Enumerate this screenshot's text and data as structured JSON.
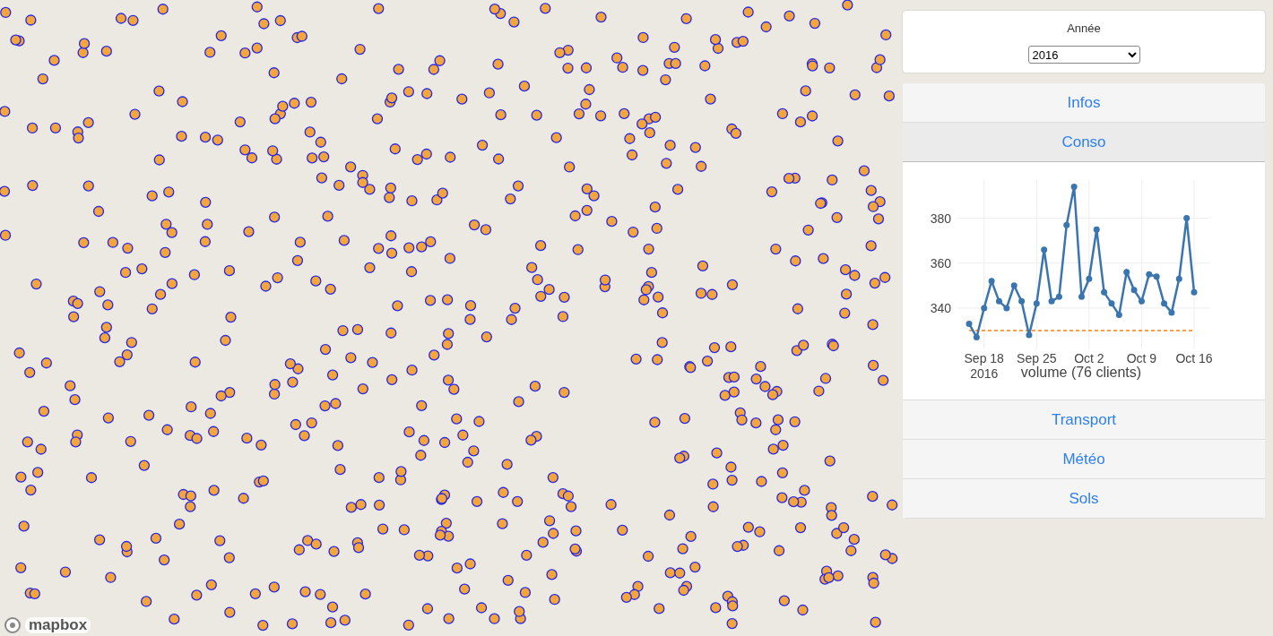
{
  "map": {
    "attribution": "mapbox"
  },
  "panel": {
    "year": {
      "label": "Année",
      "value": "2016"
    },
    "sections": [
      {
        "label": "Infos",
        "expanded": false
      },
      {
        "label": "Conso",
        "expanded": true,
        "chart_data": {
          "type": "line",
          "xlabel": "volume (76 clients)",
          "x": [
            "2016-09-16",
            "2016-09-17",
            "2016-09-18",
            "2016-09-19",
            "2016-09-20",
            "2016-09-21",
            "2016-09-22",
            "2016-09-23",
            "2016-09-24",
            "2016-09-25",
            "2016-09-26",
            "2016-09-27",
            "2016-09-28",
            "2016-09-29",
            "2016-09-30",
            "2016-10-01",
            "2016-10-02",
            "2016-10-03",
            "2016-10-04",
            "2016-10-05",
            "2016-10-06",
            "2016-10-07",
            "2016-10-08",
            "2016-10-09",
            "2016-10-10",
            "2016-10-11",
            "2016-10-12",
            "2016-10-13",
            "2016-10-14",
            "2016-10-15",
            "2016-10-16"
          ],
          "series": [
            {
              "color": "#3a75b0",
              "marker": true,
              "values": [
                333,
                327,
                340,
                352,
                343,
                340,
                350,
                343,
                328,
                342,
                366,
                343,
                345,
                377,
                394,
                345,
                353,
                375,
                347,
                342,
                337,
                356,
                348,
                343,
                355,
                354,
                342,
                338,
                353,
                380,
                347
              ]
            }
          ],
          "ylim": [
            322,
            397
          ],
          "xlim": [
            "2016-09-16",
            "2016-10-16"
          ],
          "grid": true,
          "yticks": [
            340,
            360,
            380
          ],
          "xticks": [
            {
              "value": "2016-09-18",
              "label": "Sep 18 2016"
            },
            {
              "value": "2016-09-25",
              "label": "Sep 25"
            },
            {
              "value": "2016-10-02",
              "label": "Oct 2"
            },
            {
              "value": "2016-10-09",
              "label": "Oct 9"
            },
            {
              "value": "2016-10-16",
              "label": "Oct 16"
            }
          ],
          "ref_lines": [
            {
              "axis": "y",
              "value": 330
            }
          ]
        }
      },
      {
        "label": "Transport",
        "expanded": false
      },
      {
        "label": "Météo",
        "expanded": false
      },
      {
        "label": "Sols",
        "expanded": false
      }
    ]
  }
}
